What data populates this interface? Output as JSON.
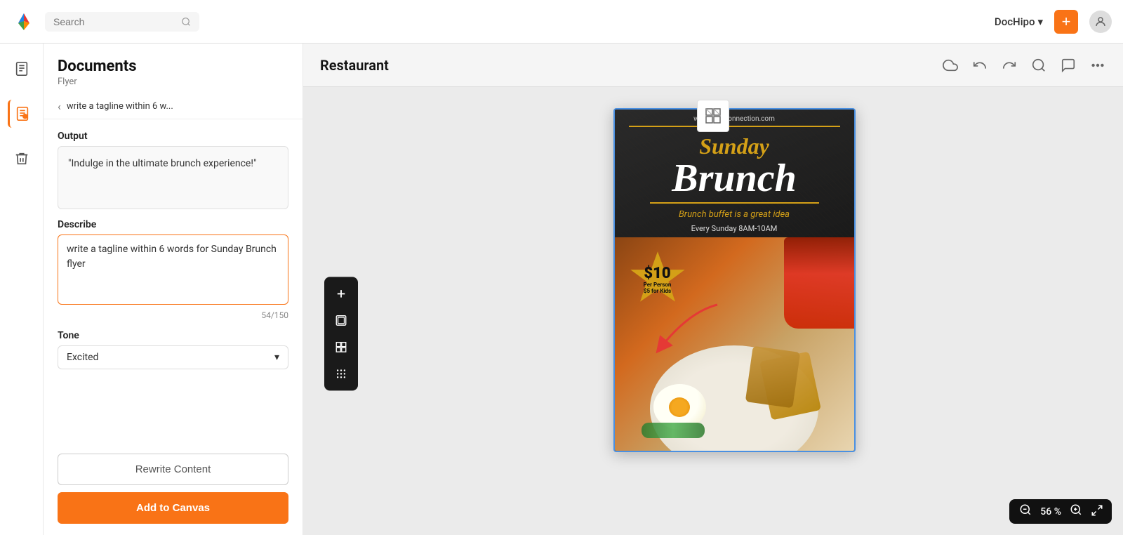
{
  "topbar": {
    "search_placeholder": "Search",
    "brand_name": "DocHipo",
    "chevron": "▾",
    "plus_label": "+",
    "avatar_label": "User"
  },
  "left_panel": {
    "title": "Documents",
    "subtitle": "Flyer",
    "breadcrumb_back": "‹",
    "breadcrumb_text": "write a tagline within 6 w...",
    "output_label": "Output",
    "output_text": "\"Indulge in the ultimate brunch experience!\"",
    "describe_label": "Describe",
    "describe_value": "write a tagline within 6 words for Sunday Brunch flyer",
    "char_count": "54/150",
    "tone_label": "Tone",
    "tone_value": "Excited",
    "tone_chevron": "▾",
    "rewrite_label": "Rewrite Content",
    "add_canvas_label": "Add to Canvas"
  },
  "canvas": {
    "title": "Restaurant",
    "tools": {
      "cloud": "☁",
      "undo": "↩",
      "redo": "↪",
      "search": "⌕",
      "chat": "💬",
      "more": "⋯"
    }
  },
  "flyer": {
    "url": "www.cafeconnection.com",
    "sunday": "Sunday",
    "brunch": "Brunch",
    "tagline": "Brunch buffet is a great idea",
    "schedule": "Every Sunday 8AM-10AM",
    "price": "$10",
    "price_sub1": "Per Person",
    "price_sub2": "$5 for Kids"
  },
  "zoom": {
    "zoom_out": "⊖",
    "zoom_value": "56 %",
    "zoom_in": "⊕",
    "fullscreen": "⛶"
  },
  "floating_toolbar": {
    "plus_icon": "+",
    "layers_icon": "⧉",
    "grid_icon": "⊞",
    "dots_icon": "⠿"
  },
  "icons": {
    "search": "🔍",
    "doc": "📄",
    "edit": "✏",
    "trash": "🗑",
    "pattern": "▨"
  }
}
